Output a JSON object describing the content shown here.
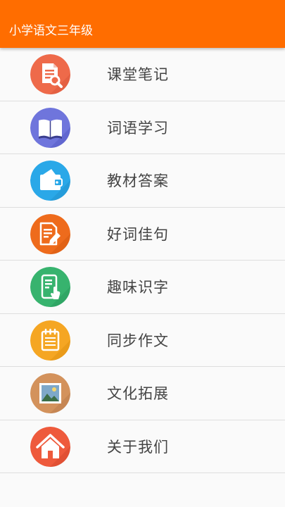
{
  "app": {
    "title": "小学语文三年级",
    "accent_color": "#ff6d00"
  },
  "menu": {
    "items": [
      {
        "label": "课堂笔记",
        "icon": "notes-search-icon",
        "color": "#ee6a4a"
      },
      {
        "label": "词语学习",
        "icon": "open-book-icon",
        "color": "#6f75dc"
      },
      {
        "label": "教材答案",
        "icon": "wallet-icon",
        "color": "#2aa8e8"
      },
      {
        "label": "好词佳句",
        "icon": "note-pencil-icon",
        "color": "#ee6b1c"
      },
      {
        "label": "趣味识字",
        "icon": "phone-touch-icon",
        "color": "#37b36e"
      },
      {
        "label": "同步作文",
        "icon": "notepad-icon",
        "color": "#f5a623"
      },
      {
        "label": "文化拓展",
        "icon": "picture-icon",
        "color": "#d3925c"
      },
      {
        "label": "关于我们",
        "icon": "home-icon",
        "color": "#ee5a3c"
      }
    ]
  }
}
